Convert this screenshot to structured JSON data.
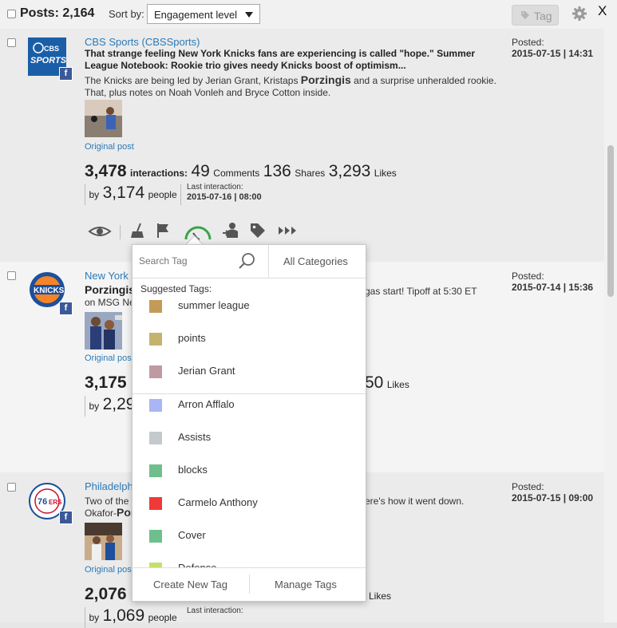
{
  "header": {
    "posts_label": "Posts: 2,164",
    "sort_by_label": "Sort by:",
    "sort_value": "Engagement level",
    "tag_button": "Tag",
    "close_label": "X"
  },
  "posts": [
    {
      "source": "CBS Sports (CBSSports)",
      "headline": "That strange feeling New York Knicks fans are experiencing is called \"hope.\" Summer League Notebook: Rookie trio gives needy Knicks boost of optimism...",
      "body_before": "The Knicks are being led by Jerian Grant, Kristaps ",
      "body_highlight": "Porzingis",
      "body_after": " and a surprise unheralded rookie. That, plus notes on Noah Vonleh and Bryce Cotton inside.",
      "original_post": "Original post",
      "interactions": "3,478",
      "interactions_label": "interactions:",
      "comments": "49",
      "comments_label": "Comments",
      "shares": "136",
      "shares_label": "Shares",
      "likes": "3,293",
      "likes_label": "Likes",
      "by_label": "by",
      "people": "3,174",
      "people_label": "people",
      "last_interaction_label": "Last interaction:",
      "last_interaction": "2015-07-16 | 08:00",
      "posted_label": "Posted:",
      "posted": "2015-07-15 | 14:31"
    },
    {
      "source": "New York K",
      "headline": "Porzingis",
      "body_right": "gas start! Tipoff at 5:30 ET",
      "body_line2": "on MSG Ne",
      "original_post": "Original post",
      "interactions": "3,175",
      "likes_partial": "50",
      "likes_label": "Likes",
      "by_label": "by",
      "people": "2,29",
      "posted_label": "Posted:",
      "posted": "2015-07-14 | 15:36"
    },
    {
      "source": "Philadelphi",
      "body_line1": "Two of the",
      "body_right": "ere's how it went down.",
      "body_line2_a": "Okafor-",
      "body_line2_b": "Por",
      "original_post": "Original post",
      "interactions": "2,076",
      "likes_label": "Likes",
      "by_label": "by",
      "people": "1,069",
      "people_label": "people",
      "last_interaction_label": "Last interaction:",
      "posted_label": "Posted:",
      "posted": "2015-07-15 | 09:00"
    }
  ],
  "tag_dropdown": {
    "search_placeholder": "Search Tag",
    "all_categories": "All Categories",
    "suggested_label": "Suggested Tags:",
    "suggested": [
      {
        "name": "summer league",
        "color": "#c49a58"
      },
      {
        "name": "points",
        "color": "#c4b36e"
      },
      {
        "name": "Jerian Grant",
        "color": "#bf9aa3"
      }
    ],
    "tags": [
      {
        "name": "Arron Afflalo",
        "color": "#a9b6f5"
      },
      {
        "name": "Assists",
        "color": "#c2cacd"
      },
      {
        "name": "blocks",
        "color": "#6fbf8e"
      },
      {
        "name": "Carmelo Anthony",
        "color": "#f03a3a"
      },
      {
        "name": "Cover",
        "color": "#6fbf8e"
      },
      {
        "name": "Defense",
        "color": "#c5e06a"
      }
    ],
    "create_label": "Create New Tag",
    "manage_label": "Manage Tags"
  }
}
